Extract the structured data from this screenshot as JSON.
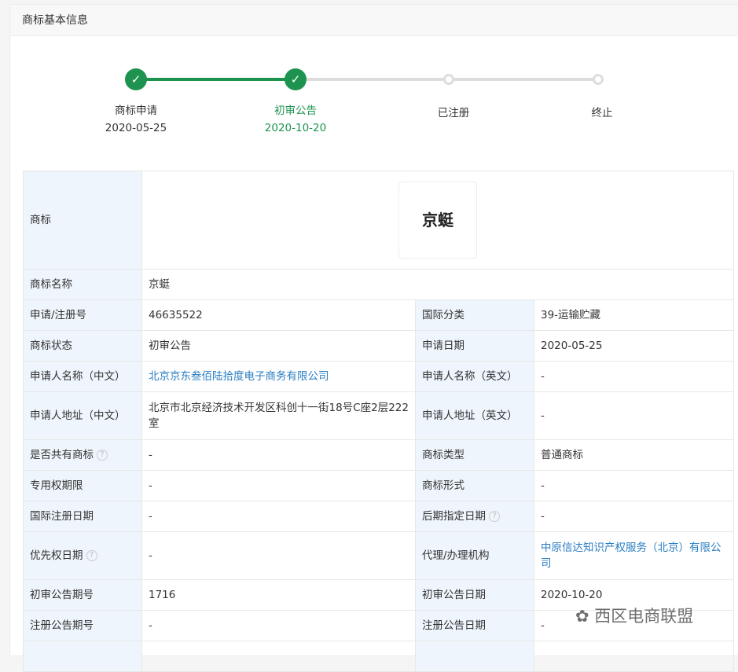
{
  "header": {
    "title": "商标基本信息"
  },
  "steps": [
    {
      "label": "商标申请",
      "date": "2020-05-25",
      "status": "done"
    },
    {
      "label": "初审公告",
      "date": "2020-10-20",
      "status": "current"
    },
    {
      "label": "已注册",
      "date": "",
      "status": "todo"
    },
    {
      "label": "终止",
      "date": "",
      "status": "todo"
    }
  ],
  "colors": {
    "green": "#1e9350",
    "link": "#2a7ec3",
    "label_bg": "#eef5fc"
  },
  "table": {
    "logo_label": "商标",
    "logo_text": "京蜓",
    "name_label": "商标名称",
    "name": "京蜓",
    "rows": [
      {
        "l1": "申请/注册号",
        "v1": "46635522",
        "l2": "国际分类",
        "v2": "39-运输贮藏"
      },
      {
        "l1": "商标状态",
        "v1": "初审公告",
        "l2": "申请日期",
        "v2": "2020-05-25"
      },
      {
        "l1": "申请人名称（中文）",
        "v1": "北京京东叁佰陆拾度电子商务有限公司",
        "l2": "申请人名称（英文）",
        "v2": "-"
      },
      {
        "l1": "申请人地址（中文）",
        "v1": "北京市北京经济技术开发区科创十一街18号C座2层222室",
        "l2": "申请人地址（英文）",
        "v2": "-"
      },
      {
        "l1": "是否共有商标",
        "v1": "-",
        "l2": "商标类型",
        "v2": "普通商标"
      },
      {
        "l1": "专用权期限",
        "v1": "-",
        "l2": "商标形式",
        "v2": "-"
      },
      {
        "l1": "国际注册日期",
        "v1": "-",
        "l2": "后期指定日期",
        "v2": "-"
      },
      {
        "l1": "优先权日期",
        "v1": "-",
        "l2": "代理/办理机构",
        "v2": "中原信达知识产权服务（北京）有限公司"
      },
      {
        "l1": "初审公告期号",
        "v1": "1716",
        "l2": "初审公告日期",
        "v2": "2020-10-20"
      },
      {
        "l1": "注册公告期号",
        "v1": "-",
        "l2": "注册公告日期",
        "v2": "-"
      }
    ]
  },
  "help_icon": "?",
  "watermark": "西区电商联盟"
}
